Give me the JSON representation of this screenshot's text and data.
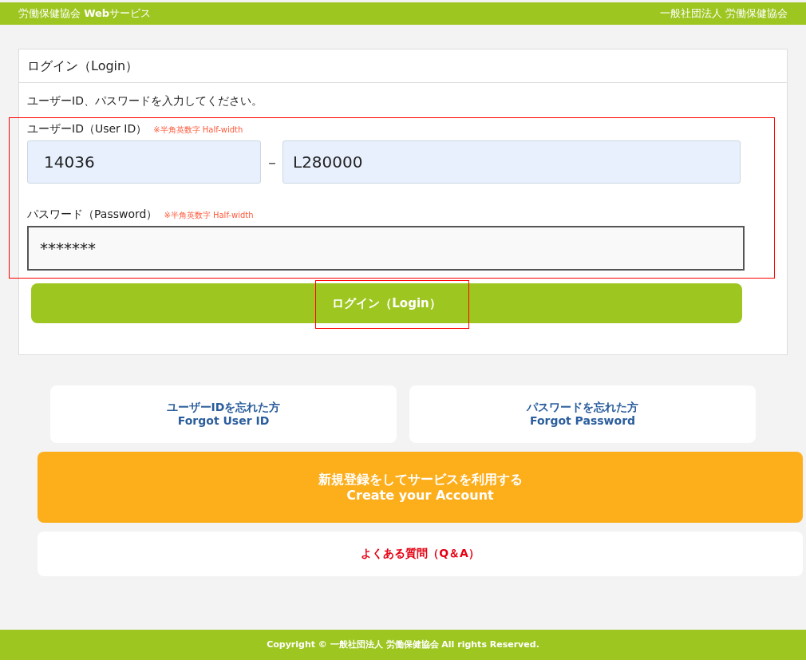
{
  "header": {
    "site_title": "労働保健協会 **Web**サービス",
    "organization": "一般社団法人 労働保健協会"
  },
  "login_panel": {
    "title": "ログイン（Login）",
    "instruction": "ユーザーID、パスワードを入力してください。",
    "credentials_highlighted": true,
    "user_id": {
      "label": "ユーザーID（User ID）",
      "hint": "※半角英数字 Half-width",
      "value_1": "14036",
      "separator": "－",
      "value_2": "L280000"
    },
    "password": {
      "label": "パスワード（Password）",
      "hint": "※半角英数字 Half-width",
      "value": "*******"
    },
    "login_button": {
      "label": "ログイン（Login）",
      "highlighted": true
    }
  },
  "links": [
    {
      "kind": "help",
      "lines": [
        "ユーザーIDを忘れた方",
        "Forgot User ID"
      ]
    },
    {
      "kind": "help",
      "lines": [
        "パスワードを忘れた方",
        "Forgot Password"
      ]
    },
    {
      "kind": "signup",
      "lines": [
        "新規登録をしてサービスを利用する",
        "Create your Account"
      ]
    },
    {
      "kind": "faq",
      "lines": [
        "よくある質問（Q＆A）"
      ]
    }
  ],
  "footer": {
    "copyright": "Copyright © 一般社団法人 労働保健協会 All rights Reserved."
  }
}
